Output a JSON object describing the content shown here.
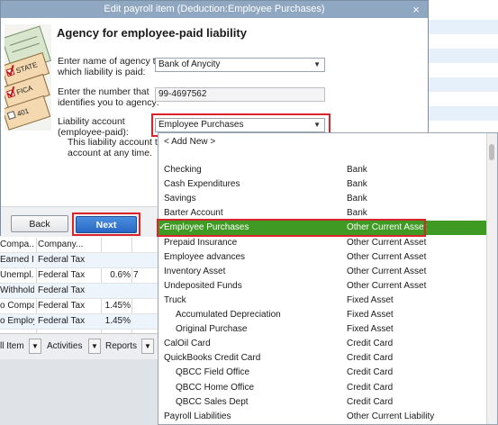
{
  "dialog": {
    "title": "Edit payroll item (Deduction:Employee Purchases)",
    "close_glyph": "×",
    "heading": "Agency for employee-paid liability",
    "agency_label_1": "Enter name of agency to",
    "agency_label_2": "which liability is paid:",
    "agency_value": "Bank of Anycity",
    "number_label_1": "Enter the number that",
    "number_label_2": "identifies you to agency:",
    "number_value": "99-4697562",
    "liability_label_1": "Liability account",
    "liability_label_2": "(employee-paid):",
    "liability_value": "Employee Purchases",
    "track_text_1": "This liability account track",
    "track_text_2": "account at any time.",
    "back_label": "Back",
    "next_label": "Next",
    "illustration_labels": [
      "STATE",
      "FICA",
      "401"
    ]
  },
  "payroll_grid": {
    "rows": [
      {
        "c1": "Compa...",
        "c2": "Company...",
        "c3": "",
        "c4": ""
      },
      {
        "c1": "Earned I...",
        "c2": "Federal Tax",
        "c3": "",
        "c4": ""
      },
      {
        "c1": "Unempl...",
        "c2": "Federal Tax",
        "c3": "0.6%",
        "c4": "7"
      },
      {
        "c1": "Withhold...",
        "c2": "Federal Tax",
        "c3": "",
        "c4": ""
      },
      {
        "c1": "o Compa...",
        "c2": "Federal Tax",
        "c3": "1.45%",
        "c4": ""
      },
      {
        "c1": "o Employ...",
        "c2": "Federal Tax",
        "c3": "1.45%",
        "c4": ""
      }
    ]
  },
  "toolbar": {
    "item_label": "ll Item",
    "activities_label": "Activities",
    "reports_label": "Reports"
  },
  "account_dropdown": {
    "add_new": "< Add New >",
    "items": [
      {
        "name": "Checking",
        "type": "Bank",
        "indent": 0,
        "selected": false
      },
      {
        "name": "Cash Expenditures",
        "type": "Bank",
        "indent": 0,
        "selected": false
      },
      {
        "name": "Savings",
        "type": "Bank",
        "indent": 0,
        "selected": false
      },
      {
        "name": "Barter Account",
        "type": "Bank",
        "indent": 0,
        "selected": false
      },
      {
        "name": "Employee Purchases",
        "type": "Other Current Asset",
        "indent": 0,
        "selected": true
      },
      {
        "name": "Prepaid Insurance",
        "type": "Other Current Asset",
        "indent": 0,
        "selected": false
      },
      {
        "name": "Employee advances",
        "type": "Other Current Asset",
        "indent": 0,
        "selected": false
      },
      {
        "name": "Inventory Asset",
        "type": "Other Current Asset",
        "indent": 0,
        "selected": false
      },
      {
        "name": "Undeposited Funds",
        "type": "Other Current Asset",
        "indent": 0,
        "selected": false
      },
      {
        "name": "Truck",
        "type": "Fixed Asset",
        "indent": 0,
        "selected": false
      },
      {
        "name": "Accumulated Depreciation",
        "type": "Fixed Asset",
        "indent": 1,
        "selected": false
      },
      {
        "name": "Original Purchase",
        "type": "Fixed Asset",
        "indent": 1,
        "selected": false
      },
      {
        "name": "CalOil Card",
        "type": "Credit Card",
        "indent": 0,
        "selected": false
      },
      {
        "name": "QuickBooks Credit Card",
        "type": "Credit Card",
        "indent": 0,
        "selected": false
      },
      {
        "name": "QBCC Field Office",
        "type": "Credit Card",
        "indent": 1,
        "selected": false
      },
      {
        "name": "QBCC Home Office",
        "type": "Credit Card",
        "indent": 1,
        "selected": false
      },
      {
        "name": "QBCC Sales Dept",
        "type": "Credit Card",
        "indent": 1,
        "selected": false
      },
      {
        "name": "Payroll Liabilities",
        "type": "Other Current Liability",
        "indent": 0,
        "selected": false
      }
    ]
  },
  "colors": {
    "titlebar": "#8fa7c0",
    "selection": "#3f9a23",
    "highlight_box": "#d8242a",
    "primary_button": "#2a68c4"
  }
}
